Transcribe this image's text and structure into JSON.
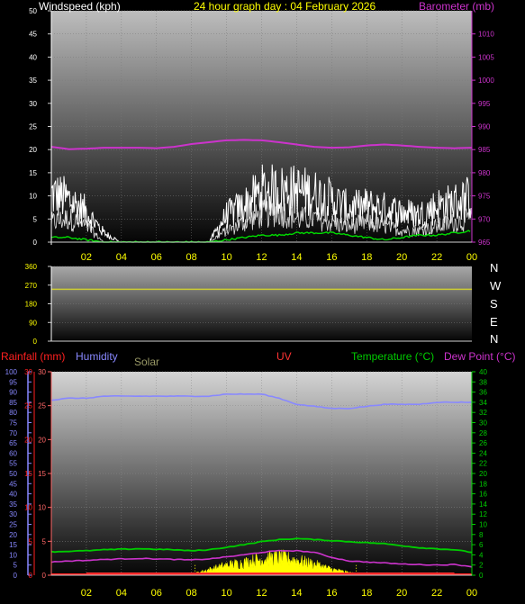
{
  "header": {
    "windspeed_label": "Windspeed (kph)",
    "title": "24 hour graph day : 04 February 2026",
    "barometer_label": "Barometer (mb)"
  },
  "bottom_header": {
    "rainfall": "Rainfall (mm)",
    "humidity": "Humidity",
    "solar": "Solar",
    "uv": "UV",
    "temperature": "Temperature (°C)",
    "dewpoint": "Dew Point (°C)"
  },
  "x_ticks": [
    "02",
    "04",
    "06",
    "08",
    "10",
    "12",
    "14",
    "16",
    "18",
    "20",
    "22",
    "00"
  ],
  "compass": [
    "N",
    "W",
    "S",
    "E",
    "N"
  ],
  "colors": {
    "windspeed": "#ffffff",
    "windgust": "#ffffff",
    "wind_avg": "#00dd00",
    "barometer": "#cc33cc",
    "direction": "#cccc33",
    "rainfall": "#ff2020",
    "humidity": "#8888ff",
    "solar": "#ffff00",
    "uv": "#ff3333",
    "temperature": "#00cc00",
    "dewpoint": "#cc33cc",
    "header_title": "#ffff00",
    "header_label": "#ffffff"
  },
  "chart_data": [
    {
      "type": "line",
      "name": "wind-barometer",
      "y_left": {
        "label": "Windspeed (kph)",
        "min": 0,
        "max": 50,
        "ticks": [
          0,
          5,
          10,
          15,
          20,
          25,
          30,
          35,
          40,
          45,
          50
        ]
      },
      "y_right": {
        "label": "Barometer (mb)",
        "min": 965,
        "max": 1015,
        "ticks": [
          965,
          970,
          975,
          980,
          985,
          990,
          995,
          1000,
          1005,
          1010
        ]
      },
      "x_hours": [
        0,
        1,
        2,
        3,
        4,
        5,
        6,
        7,
        8,
        9,
        10,
        11,
        12,
        13,
        14,
        15,
        16,
        17,
        18,
        19,
        20,
        21,
        22,
        23,
        24
      ],
      "series": [
        {
          "role": "windspeed",
          "values": [
            5,
            6,
            4,
            0,
            0,
            0,
            0,
            0,
            0,
            0,
            3,
            5,
            7,
            8,
            6,
            6,
            5,
            4,
            5,
            4,
            3,
            3,
            4,
            5,
            6
          ]
        },
        {
          "role": "windgust",
          "values": [
            16,
            14,
            10,
            3,
            0,
            0,
            0,
            0,
            0,
            0,
            9,
            12,
            17,
            17,
            17,
            16,
            14,
            11,
            12,
            11,
            10,
            9,
            12,
            13,
            15
          ]
        },
        {
          "role": "average",
          "values": [
            1,
            1,
            0.5,
            0,
            0,
            0,
            0,
            0,
            0,
            0,
            0.5,
            1,
            1.5,
            1.5,
            2,
            2,
            2,
            1.5,
            1,
            0.5,
            1,
            1.5,
            1.5,
            2,
            2.5
          ]
        },
        {
          "role": "barometer",
          "values": [
            985.6,
            985.1,
            985.2,
            985.4,
            985.4,
            985.4,
            985.3,
            985.6,
            986.2,
            986.6,
            987.0,
            987.1,
            987.0,
            986.6,
            986.1,
            985.6,
            985.4,
            985.5,
            985.9,
            986.1,
            985.9,
            985.6,
            985.4,
            985.3,
            985.4
          ]
        }
      ]
    },
    {
      "type": "line",
      "name": "wind-direction",
      "y_left": {
        "min": 0,
        "max": 360,
        "ticks": [
          0,
          90,
          180,
          270,
          360
        ]
      },
      "x_hours": [
        0,
        24
      ],
      "series": [
        {
          "role": "direction",
          "values": [
            250,
            250
          ]
        }
      ]
    },
    {
      "type": "line",
      "name": "rain-humidity-solar-temperature",
      "y_humidity": {
        "min": 0,
        "max": 100,
        "ticks": [
          0,
          5,
          10,
          15,
          20,
          25,
          30,
          35,
          40,
          45,
          50,
          55,
          60,
          65,
          70,
          75,
          80,
          85,
          90,
          95,
          100
        ]
      },
      "y_rainfall": {
        "min": 0,
        "max": 30,
        "ticks": [
          0,
          5,
          10,
          15,
          20,
          25,
          30
        ]
      },
      "y_uv": {
        "min": 0,
        "max": 30,
        "ticks": [
          0,
          5,
          10,
          15,
          20,
          25,
          30
        ],
        "secondary_ticks": [
          0,
          5,
          10,
          15,
          20,
          25,
          30,
          35,
          40
        ]
      },
      "y_temperature": {
        "min": 0,
        "max": 40,
        "ticks": [
          0,
          2,
          4,
          6,
          8,
          10,
          12,
          14,
          16,
          18,
          20,
          22,
          24,
          26,
          28,
          30,
          32,
          34,
          36,
          38,
          40
        ]
      },
      "x_hours": [
        0,
        1,
        2,
        3,
        4,
        5,
        6,
        7,
        8,
        9,
        10,
        11,
        12,
        13,
        14,
        15,
        16,
        17,
        18,
        19,
        20,
        21,
        22,
        23,
        24
      ],
      "series": [
        {
          "role": "humidity",
          "values": [
            86,
            87,
            87,
            88,
            88,
            88,
            88,
            88,
            88,
            88,
            89,
            89,
            89,
            87,
            84,
            83,
            82,
            82,
            83,
            84,
            84,
            84,
            85,
            85,
            85
          ]
        },
        {
          "role": "temperature",
          "values": [
            4.6,
            4.7,
            4.8,
            5.0,
            5.1,
            5.2,
            5.1,
            5.0,
            4.8,
            5.0,
            5.5,
            6.0,
            6.6,
            7.0,
            7.2,
            7.0,
            6.8,
            6.6,
            6.4,
            6.2,
            5.8,
            5.4,
            5.2,
            5.0,
            4.5
          ]
        },
        {
          "role": "dewpoint",
          "values": [
            2.6,
            2.8,
            2.9,
            3.1,
            3.2,
            3.3,
            3.2,
            3.1,
            3.0,
            3.2,
            3.6,
            4.0,
            4.5,
            4.8,
            4.8,
            4.5,
            3.5,
            2.8,
            2.6,
            2.4,
            2.2,
            2.1,
            2.0,
            2.1,
            1.7
          ]
        },
        {
          "role": "solar_peak",
          "values": [
            0,
            0,
            0,
            0,
            0,
            0,
            0,
            0,
            0.2,
            1.4,
            2.5,
            3.2,
            4.1,
            4.5,
            3.8,
            2.8,
            1.5,
            0.6,
            0,
            0,
            0,
            0,
            0,
            0,
            0
          ]
        },
        {
          "role": "rainfall",
          "values": [
            0,
            0,
            0,
            0,
            0,
            0,
            0,
            0,
            0,
            0,
            0,
            0,
            0,
            0,
            0,
            0,
            0,
            0,
            0,
            0,
            0,
            0,
            0,
            0,
            0
          ]
        },
        {
          "role": "uv",
          "values": [
            0,
            0,
            0,
            0,
            0,
            0,
            0,
            0,
            0,
            0,
            0,
            0,
            0,
            0,
            0,
            0,
            0,
            0,
            0,
            0,
            0,
            0,
            0,
            0,
            0
          ]
        }
      ],
      "markers_hours": [
        8.2,
        17.4
      ]
    }
  ]
}
